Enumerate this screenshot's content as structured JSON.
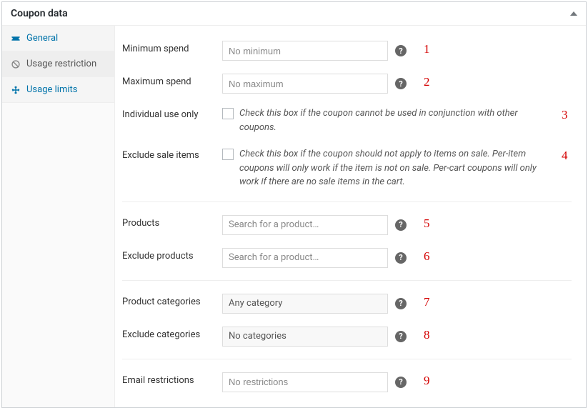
{
  "header": {
    "title": "Coupon data"
  },
  "tabs": [
    {
      "id": "general",
      "label": "General"
    },
    {
      "id": "usage-restriction",
      "label": "Usage restriction"
    },
    {
      "id": "usage-limits",
      "label": "Usage limits"
    }
  ],
  "fields": {
    "min_spend": {
      "label": "Minimum spend",
      "placeholder": "No minimum",
      "annotation": "1"
    },
    "max_spend": {
      "label": "Maximum spend",
      "placeholder": "No maximum",
      "annotation": "2"
    },
    "individual_use": {
      "label": "Individual use only",
      "desc": "Check this box if the coupon cannot be used in conjunction with other coupons.",
      "annotation": "3"
    },
    "exclude_sale": {
      "label": "Exclude sale items",
      "desc": "Check this box if the coupon should not apply to items on sale. Per-item coupons will only work if the item is not on sale. Per-cart coupons will only work if there are no sale items in the cart.",
      "annotation": "4"
    },
    "products": {
      "label": "Products",
      "placeholder": "Search for a product…",
      "annotation": "5"
    },
    "exclude_products": {
      "label": "Exclude products",
      "placeholder": "Search for a product…",
      "annotation": "6"
    },
    "product_categories": {
      "label": "Product categories",
      "placeholder": "Any category",
      "annotation": "7"
    },
    "exclude_categories": {
      "label": "Exclude categories",
      "placeholder": "No categories",
      "annotation": "8"
    },
    "email_restrictions": {
      "label": "Email restrictions",
      "placeholder": "No restrictions",
      "annotation": "9"
    }
  }
}
